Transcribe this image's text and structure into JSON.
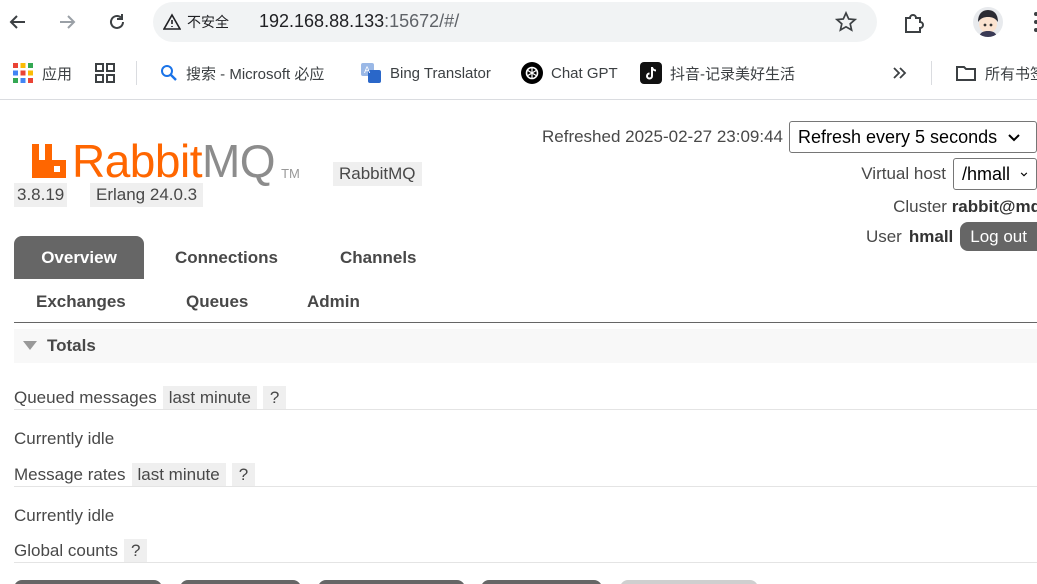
{
  "browser": {
    "security_label": "不安全",
    "url_host": "192.168.88.133",
    "url_rest": ":15672/#/",
    "bookmarks": [
      {
        "label": "应用"
      },
      {
        "label": "搜索 - Microsoft 必应"
      },
      {
        "label": "Bing Translator"
      },
      {
        "label": "Chat GPT"
      },
      {
        "label": "抖音-记录美好生活"
      },
      {
        "label": "所有书签"
      }
    ]
  },
  "app": {
    "logo_rabbit": "Rabbit",
    "logo_mq": "MQ",
    "logo_tm": "TM",
    "product_badge": "RabbitMQ",
    "version": "3.8.19",
    "erlang": "Erlang 24.0.3"
  },
  "status": {
    "refreshed_label": "Refreshed 2025-02-27 23:09:44",
    "refresh_option": "Refresh every 5 seconds",
    "vhost_label": "Virtual host",
    "vhost_value": "/hmall",
    "cluster_label": "Cluster",
    "cluster_value": "rabbit@mq",
    "user_label": "User",
    "user_value": "hmall",
    "logout_label": "Log out"
  },
  "tabs": {
    "overview": "Overview",
    "connections": "Connections",
    "channels": "Channels",
    "exchanges": "Exchanges",
    "queues": "Queues",
    "admin": "Admin"
  },
  "totals": {
    "heading": "Totals",
    "queued_label": "Queued messages",
    "queued_range": "last minute",
    "help": "?",
    "queued_state": "Currently idle",
    "rates_label": "Message rates",
    "rates_range": "last minute",
    "rates_state": "Currently idle",
    "global_label": "Global counts"
  },
  "colors": {
    "brand_orange": "#ff6600",
    "tab_active": "#666666"
  }
}
